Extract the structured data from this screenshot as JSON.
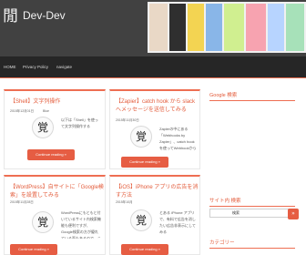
{
  "site": {
    "logo_char": "閒",
    "title": "Dev-Dev"
  },
  "nav": {
    "items": [
      {
        "label": "HOME"
      },
      {
        "label": "Privacy Policy"
      },
      {
        "label": "navigate"
      }
    ]
  },
  "posts": [
    {
      "title": "【Shell】文字列操作",
      "date": "2015年12月01日",
      "author": "Blue",
      "excerpt": "以下は「Shell」を使って文字列操作する",
      "thumb_char": "覚",
      "cta": "Continue reading »"
    },
    {
      "title": "【Zapier】catch hook から slack へメッセージを送信してみる",
      "date": "2015年11月30日",
      "author": "",
      "excerpt": "Zapierの中にある「Webhooks by Zapier」、catch hookを使ってWebhookからslack へメッセージを送信してみる",
      "thumb_char": "覚",
      "cta": "Continue reading »"
    },
    {
      "title": "【WordPress】自サイトに「Google検索」を設置してみる",
      "date": "2015年11月28日",
      "author": "",
      "excerpt": "WordPressにもともと付いているサイト内検索機能も便利ですが、Google検索の方が優れている面もあるので、ここではそのまま自サイトに設置してみる",
      "thumb_char": "覚",
      "cta": "Continue reading »"
    },
    {
      "title": "【iOS】iPhone アプリの広告を消す方法",
      "date": "2015年10月",
      "author": "",
      "excerpt": "とある iPhone アプリで、有料で広告を消したい広告非表示にしてみる",
      "thumb_char": "覚",
      "cta": "Continue reading »"
    }
  ],
  "sidebar": {
    "google_title": "Google 検索",
    "site_search_title": "サイト内 検索",
    "search_value": "検索",
    "search_btn": "»",
    "categories_title": "カテゴリー"
  },
  "colors": {
    "accent": "#e65d43",
    "header_bg": "#414141",
    "nav_bg": "#262626"
  }
}
